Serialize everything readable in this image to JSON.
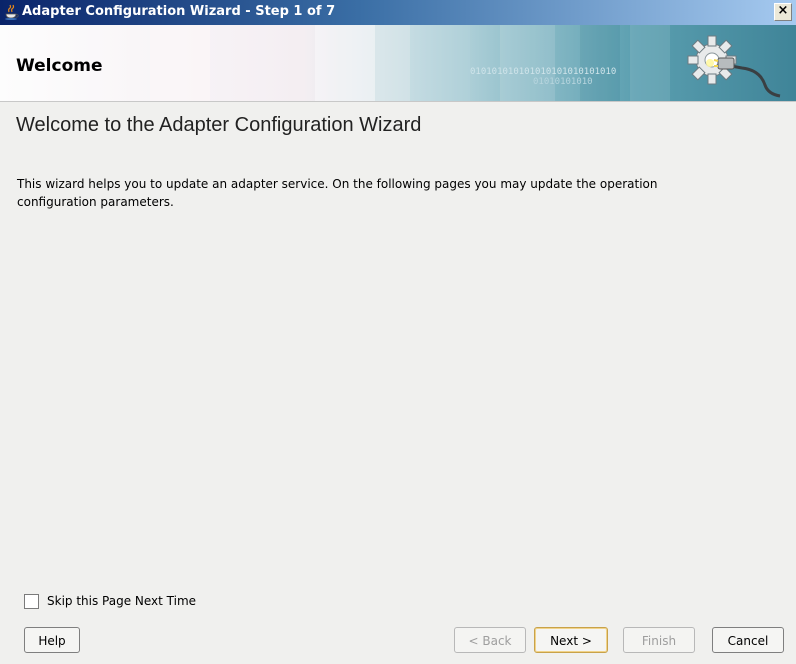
{
  "window": {
    "title": "Adapter Configuration Wizard - Step 1 of 7",
    "close_label": "×",
    "icon": "coffee-cup-icon"
  },
  "banner": {
    "heading": "Welcome",
    "binary_text": "010101010101010101010101010",
    "binary_text_2": "01010101010",
    "icon": "gear-plug-icon"
  },
  "content": {
    "title": "Welcome to the Adapter Configuration Wizard",
    "description": "This wizard helps you to update an adapter service. On the following pages you may update the operation configuration parameters."
  },
  "skip": {
    "label": "Skip this Page Next Time",
    "checked": false
  },
  "buttons": {
    "help": "Help",
    "back": "< Back",
    "next": "Next >",
    "finish": "Finish",
    "cancel": "Cancel"
  },
  "colors": {
    "titlebar_start": "#0a246a",
    "titlebar_end": "#a6caf0",
    "banner_teal": "#3f8498",
    "body_bg": "#f0f0ee"
  }
}
